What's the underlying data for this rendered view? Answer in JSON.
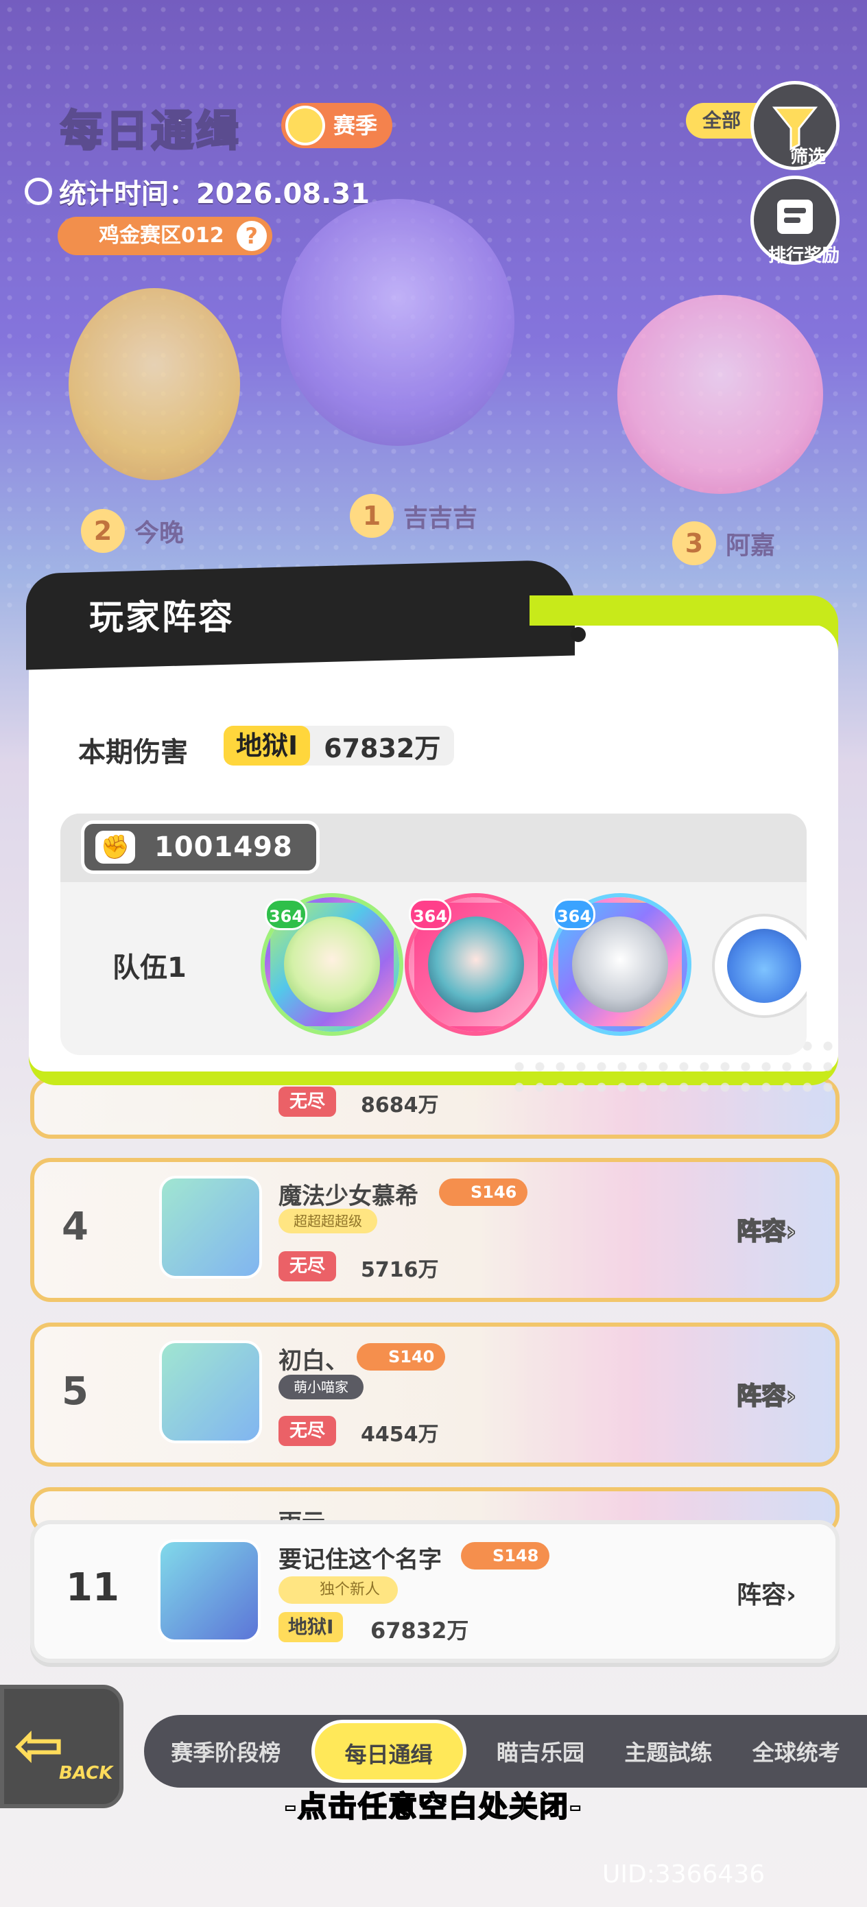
{
  "header": {
    "title": "每日通缉",
    "season_badge": "赛季",
    "stat_time": "统计时间：2026.08.31",
    "zone": "鸡金赛区012",
    "filter_all": "全部",
    "filter_label": "筛选",
    "reward_label": "排行奖励"
  },
  "podium": [
    {
      "rank": "2",
      "name": "今晚"
    },
    {
      "rank": "1",
      "name": "吉吉吉"
    },
    {
      "rank": "3",
      "name": "阿嘉"
    }
  ],
  "modal": {
    "title": "玩家阵容",
    "damage_label": "本期伤害",
    "difficulty": "地狱I",
    "damage_value": "67832万",
    "power": "1001498",
    "team_label": "队伍1",
    "heroes": [
      {
        "level": "364"
      },
      {
        "level": "364"
      },
      {
        "level": "364"
      }
    ]
  },
  "list": {
    "partial_row": {
      "difficulty": "无尽",
      "damage": "8684万"
    },
    "rows": [
      {
        "rank": "4",
        "name": "魔法少女慕希",
        "tag": "S146",
        "sub": "超超超超级",
        "difficulty": "无尽",
        "damage": "5716万",
        "button": "阵容"
      },
      {
        "rank": "5",
        "name": "初白、",
        "tag": "S140",
        "sub": "萌小喵家",
        "difficulty": "无尽",
        "damage": "4454万",
        "button": "阵容"
      }
    ],
    "cut_row": {
      "name": "雨云"
    }
  },
  "own_row": {
    "rank": "11",
    "name": "要记住这个名字",
    "tag": "S148",
    "sub": "独个新人",
    "difficulty": "地狱I",
    "damage": "67832万",
    "button": "阵容"
  },
  "nav": {
    "back": "BACK",
    "tabs": [
      "赛季阶段榜",
      "每日通缉",
      "瞄吉乐园",
      "主题試练",
      "全球统考"
    ],
    "active": "每日通缉"
  },
  "close_hint": "-点击任意空白处关闭-",
  "uid": "UID:3366436",
  "colors": {
    "accent_lime": "#c8ea1a",
    "hell_yellow": "#ffd63c",
    "endless_red": "#e8434a",
    "tag_orange": "#f37a2b"
  }
}
